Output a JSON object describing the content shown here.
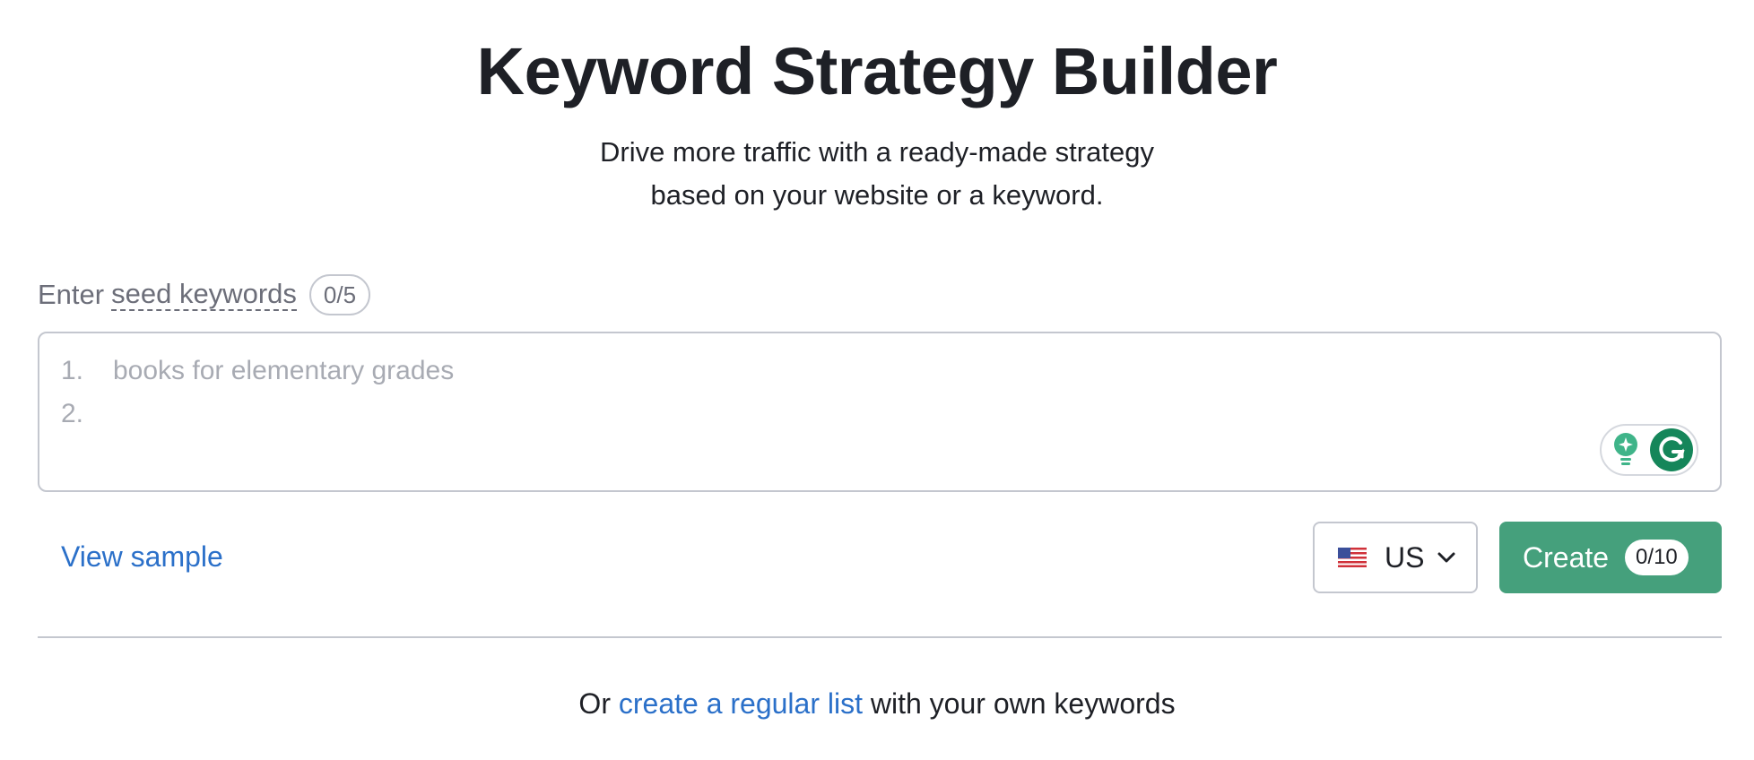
{
  "header": {
    "title": "Keyword Strategy Builder",
    "subtitle_line1": "Drive more traffic with a ready-made strategy",
    "subtitle_line2": "based on your website or a keyword."
  },
  "seed_input": {
    "label_prefix": "Enter",
    "label_term": "seed keywords",
    "counter": "0/5",
    "lines": [
      {
        "number": "1.",
        "placeholder": "books for elementary grades"
      },
      {
        "number": "2.",
        "placeholder": ""
      }
    ]
  },
  "actions": {
    "view_sample": "View sample",
    "country": "US",
    "create_label": "Create",
    "create_counter": "0/10"
  },
  "footer": {
    "prefix": "Or",
    "link": "create a regular list",
    "suffix": "with your own keywords"
  },
  "icons": {
    "flag": "us-flag-icon",
    "chevron": "chevron-down-icon",
    "bulb": "lightbulb-icon",
    "grammarly": "grammarly-icon"
  },
  "colors": {
    "primary_green": "#45a07c",
    "link_blue": "#2b70c9",
    "text_dark": "#1e2026",
    "text_muted": "#6c6e79",
    "border": "#c4c7cf"
  }
}
